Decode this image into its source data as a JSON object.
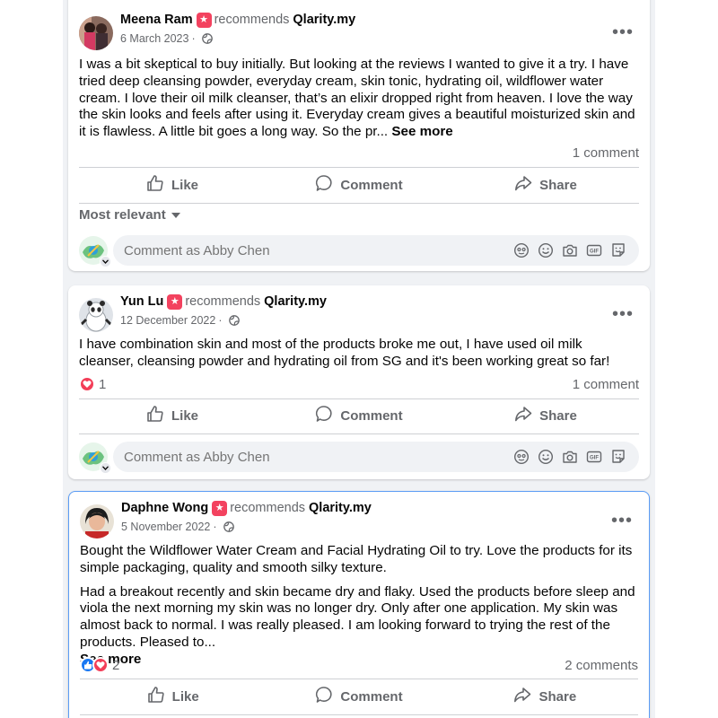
{
  "posts": [
    {
      "author": "Meena Ram",
      "recommends_text": "recommends",
      "page": "Qlarity.my",
      "date": "6 March 2023",
      "date_sep": "·",
      "paragraphs": [
        "I was a bit skeptical to buy initially. But looking at the reviews I wanted to give it a try. I have tried deep cleansing powder, everyday cream, skin tonic, hydrating oil, wildflower water cream. I love their oil milk cleanser, that’s an elixir dropped right from heaven. I love the way the skin looks and feels after using it. Everyday cream gives a beautiful moisturized skin and it is flawless. A little bit goes a long way. So the pr... "
      ],
      "see_more": "See more",
      "reaction_count": "",
      "comments_count": "1 comment",
      "sort_label": "Most relevant",
      "comment_placeholder": "Comment as Abby Chen"
    },
    {
      "author": "Yun Lu",
      "recommends_text": "recommends",
      "page": "Qlarity.my",
      "date": "12 December 2022",
      "date_sep": "·",
      "paragraphs": [
        "I have combination skin and most of the products broke me out, I have used oil milk cleanser, cleansing powder and hydrating oil from SG and it's been working great so far!"
      ],
      "reaction_count": "1",
      "comments_count": "1 comment",
      "comment_placeholder": "Comment as Abby Chen"
    },
    {
      "author": "Daphne Wong",
      "recommends_text": "recommends",
      "page": "Qlarity.my",
      "date": "5 November 2022",
      "date_sep": "·",
      "paragraphs": [
        "Bought the Wildflower Water Cream and Facial Hydrating Oil to try. Love the products for its simple packaging, quality and smooth silky texture.",
        "Had a breakout recently and skin became dry and flaky. Used the products before sleep and viola the next morning my skin was no longer dry. Only after one application. My skin was almost back to normal. I was really pleased. I am looking forward to trying the rest of the products. Pleased to..."
      ],
      "see_more": "See more",
      "reaction_count": "2",
      "comments_count": "2 comments"
    }
  ],
  "actions": {
    "like": "Like",
    "comment": "Comment",
    "share": "Share"
  },
  "more_label": "•••",
  "icons": {
    "badge": "recommend-star-icon",
    "privacy": "globe-icon",
    "like": "thumbs-up-icon",
    "comment": "speech-bubble-icon",
    "share": "share-arrow-icon",
    "composer": [
      "avatar-sticker-icon",
      "emoji-icon",
      "camera-icon",
      "gif-icon",
      "sticker-icon"
    ]
  },
  "colors": {
    "heart": "#f33e58",
    "like": "#1877f2",
    "badge": "#f3425f",
    "highlight_border": "#5b9cf5"
  }
}
